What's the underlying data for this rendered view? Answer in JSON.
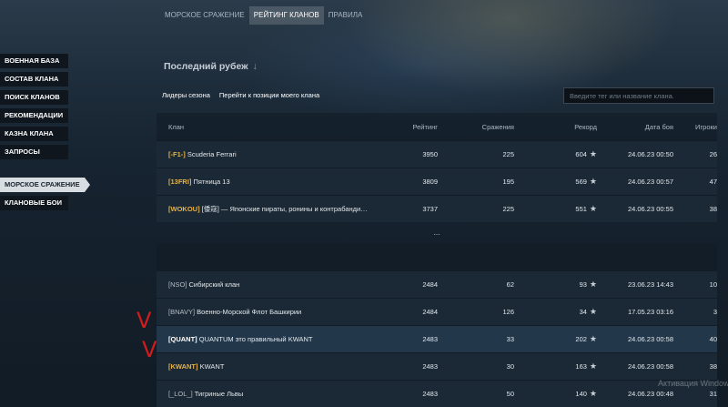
{
  "tabs": [
    {
      "label": "МОРСКОЕ СРАЖЕНИЕ",
      "active": false
    },
    {
      "label": "РЕЙТИНГ КЛАНОВ",
      "active": true
    },
    {
      "label": "ПРАВИЛА",
      "active": false
    }
  ],
  "sidebar": {
    "items": [
      {
        "label": "ВОЕННАЯ БАЗА"
      },
      {
        "label": "СОСТАВ КЛАНА"
      },
      {
        "label": "ПОИСК КЛАНОВ"
      },
      {
        "label": "РЕКОМЕНДАЦИИ"
      },
      {
        "label": "КАЗНА КЛАНА"
      },
      {
        "label": "ЗАПРОСЫ"
      }
    ],
    "items2": [
      {
        "label": "МОРСКОЕ СРАЖЕНИЕ",
        "active": true
      },
      {
        "label": "КЛАНОВЫЕ БОИ"
      }
    ]
  },
  "main": {
    "title": "Последний рубеж",
    "title_arrow": "↓",
    "links": [
      "Лидеры сезона",
      "Перейти к позиции моего клана"
    ],
    "search_placeholder": "Введите тег или название клана."
  },
  "table": {
    "headers": {
      "clan": "Клан",
      "rating": "Рейтинг",
      "battles": "Сражения",
      "record": "Рекорд",
      "date": "Дата боя",
      "players": "Игроки"
    },
    "top_rows": [
      {
        "tag": "[-F1-]",
        "name": "Scuderia Ferrari",
        "rating": "3950",
        "battles": "225",
        "record": "604",
        "date": "24.06.23 00:50",
        "players": "26"
      },
      {
        "tag": "[13FRI]",
        "name": "Пятница 13",
        "rating": "3809",
        "battles": "195",
        "record": "569",
        "date": "24.06.23 00:57",
        "players": "47"
      },
      {
        "tag": "[WOKOU]",
        "name": "[倭寇] — Японские пираты, ронины и контрабанди…",
        "rating": "3737",
        "battles": "225",
        "record": "551",
        "date": "24.06.23 00:55",
        "players": "38"
      }
    ],
    "ellipsis": "...",
    "bottom_rows": [
      {
        "tag": "[NSO]",
        "name": "Сибирский клан",
        "rating": "2484",
        "battles": "62",
        "record": "93",
        "date": "23.06.23 14:43",
        "players": "10",
        "tag_style": "g"
      },
      {
        "tag": "[BNAVY]",
        "name": "Военно-Морской Флот Башкирии",
        "rating": "2484",
        "battles": "126",
        "record": "34",
        "date": "17.05.23 03:16",
        "players": "3",
        "tag_style": "g"
      },
      {
        "tag": "[QUANT]",
        "name": "QUANTUM это правильный KWANT",
        "rating": "2483",
        "battles": "33",
        "record": "202",
        "date": "24.06.23 00:58",
        "players": "40",
        "tag_style": "w"
      },
      {
        "tag": "[KWANT]",
        "name": "KWANT",
        "rating": "2483",
        "battles": "30",
        "record": "163",
        "date": "24.06.23 00:58",
        "players": "38",
        "tag_style": "y"
      },
      {
        "tag": "[_LOL_]",
        "name": "Тигриные Львы",
        "rating": "2483",
        "battles": "50",
        "record": "140",
        "date": "24.06.23 00:48",
        "players": "31",
        "tag_style": "g"
      }
    ]
  },
  "annotations": {
    "check_mark": "V"
  },
  "watermark": "Активация Windows",
  "icons": {
    "record_star": "star-icon"
  }
}
